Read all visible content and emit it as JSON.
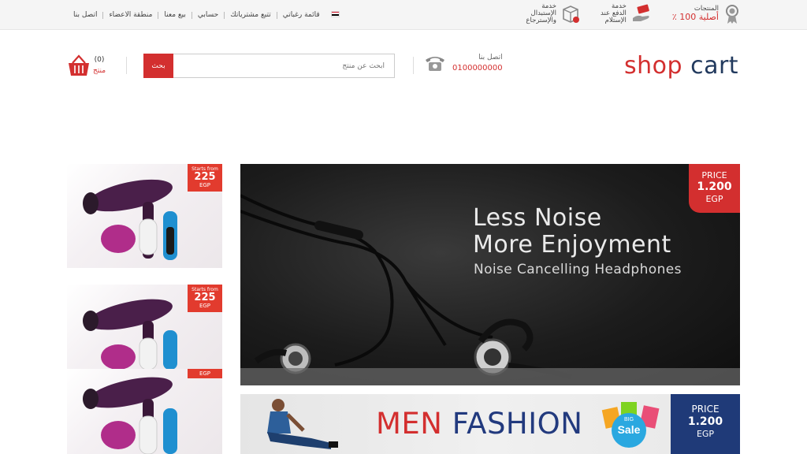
{
  "topnav": {
    "links": [
      "اتصل بنا",
      "منطقة الاعضاء",
      "بيع معنا",
      "حسابي",
      "تتبع مشترياتك",
      "قائمة رغباتي"
    ]
  },
  "features": [
    {
      "line1": "المنتجات",
      "line2": "أصلية 100 ٪",
      "icon": "medal-icon"
    },
    {
      "line1": "خدمة",
      "line2": "الدفع عند",
      "line3": "الإستلام",
      "icon": "cash-hand-icon"
    },
    {
      "line1": "خدمة",
      "line2": "الإستبدال",
      "line3": "والإسترجاع",
      "icon": "box-return-icon"
    }
  ],
  "header": {
    "logo_shop": "shop",
    "logo_cart": "cart",
    "contact_label": "اتصل بنا",
    "contact_number": "0100000000",
    "search_placeholder": "ابحث عن منتج",
    "search_button": "بحث",
    "cart_count": "(0)",
    "cart_label": "منتج"
  },
  "side_banners": [
    {
      "line1": "Starts from",
      "line2": "225",
      "line3": "EGP"
    },
    {
      "line1": "Starts from",
      "line2": "225",
      "line3": "EGP"
    },
    {
      "line1": "",
      "line2": "",
      "line3": "EGP"
    }
  ],
  "hero": {
    "line1": "Less Noise",
    "line2": "More Enjoyment",
    "line3": "Noise Cancelling Headphones",
    "price_label": "PRICE",
    "price_value": "1.200",
    "price_currency": "EGP"
  },
  "fashion": {
    "men": "MEN",
    "fashion": "FASHION",
    "sale_top": "BIG",
    "sale_main": "Sale",
    "price_label": "PRICE",
    "price_value": "1.200",
    "price_currency": "EGP"
  },
  "colors": {
    "brand_red": "#d32f2f",
    "brand_navy": "#223a5e",
    "fashion_blue": "#1f3a78"
  }
}
